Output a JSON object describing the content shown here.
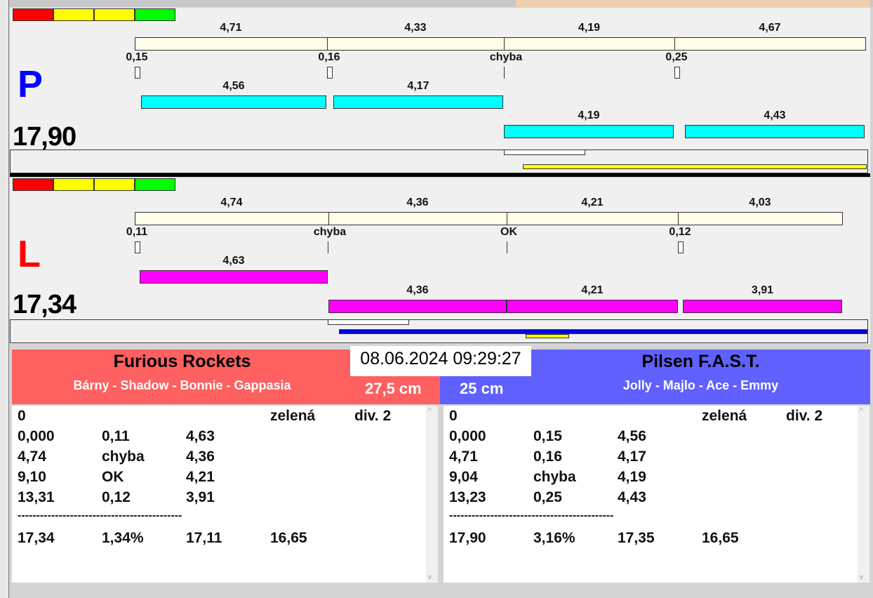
{
  "colors": {
    "lane_p": "#0000ff",
    "lane_l": "#ff0000",
    "cyan": "#00ffff",
    "magenta": "#ff00ff",
    "team_left": "#ff6060",
    "team_right": "#6060ff"
  },
  "traffic_light": [
    "red",
    "yellow",
    "yellow",
    "green"
  ],
  "lane_p": {
    "letter": "P",
    "total": "17,90",
    "splits": [
      "4,71",
      "4,33",
      "4,19",
      "4,67"
    ],
    "reactions": [
      "0,15",
      "0,16",
      "chyba",
      "0,25"
    ],
    "runs_row1": [
      "4,56",
      "4,17"
    ],
    "runs_row2": [
      "4,19",
      "4,43"
    ]
  },
  "lane_l": {
    "letter": "L",
    "total": "17,34",
    "splits": [
      "4,74",
      "4,36",
      "4,21",
      "4,03"
    ],
    "reactions": [
      "0,11",
      "chyba",
      "OK",
      "0,12"
    ],
    "runs_row1": [
      "4,63"
    ],
    "runs_row2": [
      "4,36",
      "4,21",
      "3,91"
    ]
  },
  "datetime": "08.06.2024 09:29:27",
  "team_left": {
    "name": "Furious Rockets",
    "members": "Bárny - Shadow - Bonnie - Gappasia",
    "height": "27,5 cm",
    "table": [
      [
        "0",
        "",
        "",
        "zelená",
        "div. 2"
      ],
      [
        "0,000",
        "0,11",
        "4,63",
        "",
        ""
      ],
      [
        "4,74",
        "chyba",
        "4,36",
        "",
        ""
      ],
      [
        "9,10",
        "OK",
        "4,21",
        "",
        ""
      ],
      [
        "13,31",
        "0,12",
        "3,91",
        "",
        ""
      ],
      [
        "--------------------------------------------",
        "",
        "",
        "",
        ""
      ],
      [
        "17,34",
        "1,34%",
        "17,11",
        "16,65",
        ""
      ]
    ]
  },
  "team_right": {
    "name": "Pilsen F.A.S.T.",
    "members": "Jolly - Majlo - Ace - Emmy",
    "height": "25 cm",
    "table": [
      [
        "0",
        "",
        "",
        "zelená",
        "div. 2"
      ],
      [
        "0,000",
        "0,15",
        "4,56",
        "",
        ""
      ],
      [
        "4,71",
        "0,16",
        "4,17",
        "",
        ""
      ],
      [
        "9,04",
        "chyba",
        "4,19",
        "",
        ""
      ],
      [
        "13,23",
        "0,25",
        "4,43",
        "",
        ""
      ],
      [
        "--------------------------------------------",
        "",
        "",
        "",
        ""
      ],
      [
        "17,90",
        "3,16%",
        "17,35",
        "16,65",
        ""
      ]
    ]
  }
}
